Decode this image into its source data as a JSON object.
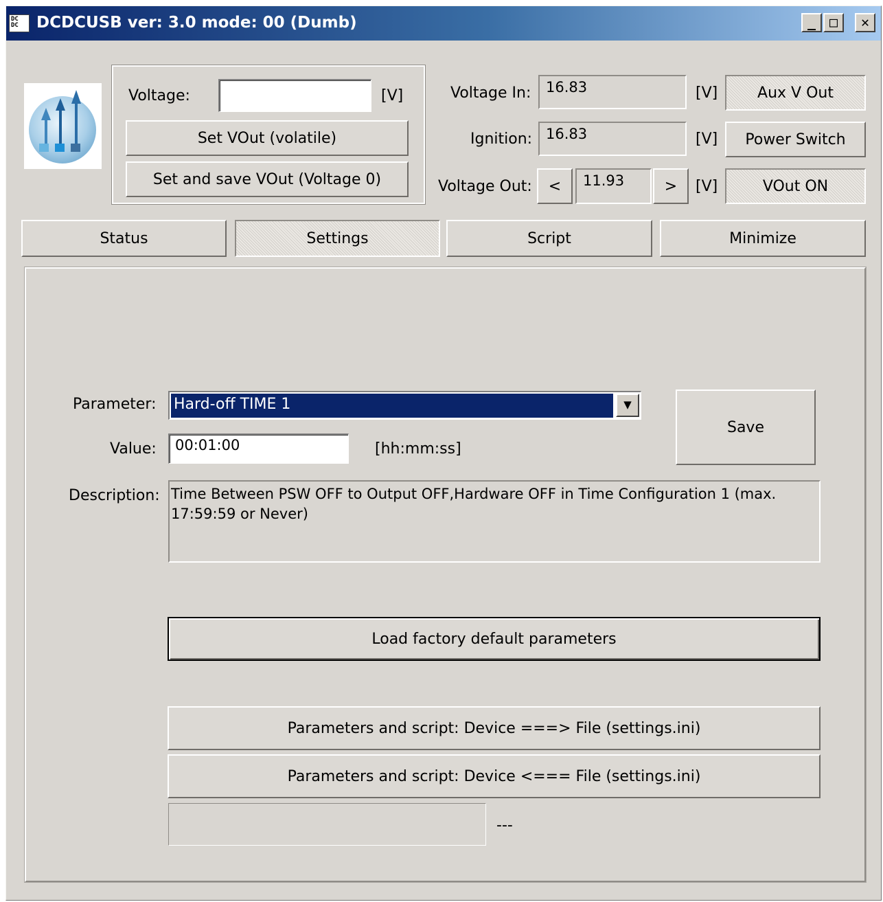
{
  "window": {
    "title": "DCDCUSB ver: 3.0 mode: 00 (Dumb)",
    "app_icon_text": "DC\nDC",
    "minimize_glyph": "_",
    "maximize_glyph": "□",
    "close_glyph": "✕"
  },
  "voltage_box": {
    "voltage_label": "Voltage:",
    "voltage_value": "",
    "unit": "[V]",
    "set_vout_label": "Set VOut (volatile)",
    "set_save_label": "Set and save VOut (Voltage 0)"
  },
  "readings": {
    "voltage_in_label": "Voltage In:",
    "voltage_in_value": "16.83",
    "ignition_label": "Ignition:",
    "ignition_value": "16.83",
    "voltage_out_label": "Voltage Out:",
    "voltage_out_value": "11.93",
    "decrease_label": "<",
    "increase_label": ">",
    "unit": "[V]"
  },
  "side_buttons": {
    "aux_v_out": "Aux V Out",
    "power_switch": "Power Switch",
    "vout_on": "VOut ON"
  },
  "tabs": [
    {
      "label": "Status"
    },
    {
      "label": "Settings"
    },
    {
      "label": "Script"
    },
    {
      "label": "Minimize"
    }
  ],
  "settings": {
    "parameter_label": "Parameter:",
    "parameter_value": "Hard-off TIME 1",
    "value_label": "Value:",
    "value_value": "00:01:00",
    "value_unit": "[hh:mm:ss]",
    "save_label": "Save",
    "description_label": "Description:",
    "description_text": "Time Between PSW OFF to Output OFF,Hardware OFF in Time Configuration 1 (max. 17:59:59 or Never)",
    "load_defaults_label": "Load factory default parameters",
    "export_label": "Parameters and script: Device ===> File (settings.ini)",
    "import_label": "Parameters and script: Device <=== File (settings.ini)",
    "progress_status": "---"
  }
}
